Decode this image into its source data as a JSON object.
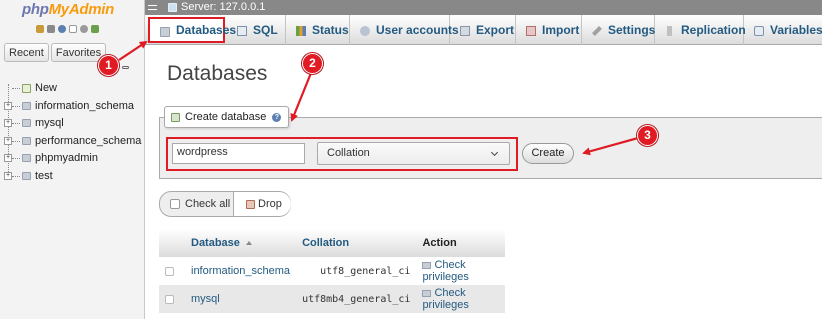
{
  "nav": {
    "logo_part1": "php",
    "logo_part2": "MyAdmin",
    "tab_recent": "Recent",
    "tab_favorites": "Favorites",
    "tree": [
      {
        "label": "New",
        "icon": "new-db-icon"
      },
      {
        "label": "information_schema",
        "icon": "database-icon"
      },
      {
        "label": "mysql",
        "icon": "database-icon"
      },
      {
        "label": "performance_schema",
        "icon": "database-icon"
      },
      {
        "label": "phpmyadmin",
        "icon": "database-icon"
      },
      {
        "label": "test",
        "icon": "database-icon"
      }
    ]
  },
  "server_bar": {
    "text": "Server: 127.0.0.1"
  },
  "menu_tabs": [
    {
      "label": "Databases",
      "icon": "database-icon",
      "active": true
    },
    {
      "label": "SQL",
      "icon": "sql-icon"
    },
    {
      "label": "Status",
      "icon": "status-icon"
    },
    {
      "label": "User accounts",
      "icon": "users-icon"
    },
    {
      "label": "Export",
      "icon": "export-icon"
    },
    {
      "label": "Import",
      "icon": "import-icon"
    },
    {
      "label": "Settings",
      "icon": "wrench-icon"
    },
    {
      "label": "Replication",
      "icon": "replication-icon"
    },
    {
      "label": "Variables",
      "icon": "variables-icon"
    }
  ],
  "content": {
    "title": "Databases",
    "create_db": {
      "legend": "Create database",
      "name_value": "wordpress",
      "collation_selected": "Collation",
      "create_label": "Create"
    },
    "check_all_label": "Check all",
    "drop_label": "Drop",
    "table": {
      "headers": [
        "Database",
        "Collation",
        "Action"
      ],
      "rows": [
        {
          "database": "information_schema",
          "collation": "utf8_general_ci",
          "action": "Check privileges"
        },
        {
          "database": "mysql",
          "collation": "utf8mb4_general_ci",
          "action": "Check privileges"
        }
      ]
    }
  },
  "annotations": [
    "1",
    "2",
    "3"
  ],
  "colors": {
    "accent_red": "#e01b24",
    "link_blue": "#235a81",
    "logo_blue": "#6c78af",
    "logo_orange": "#f89c0e"
  }
}
